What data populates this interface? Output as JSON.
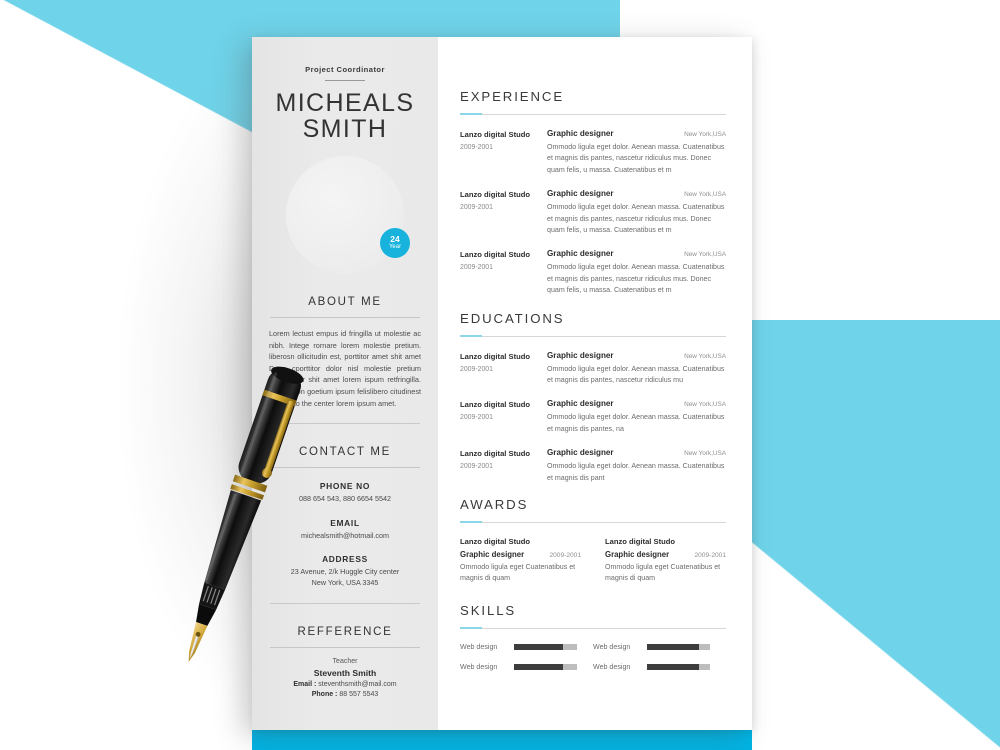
{
  "theme": {
    "accent_cyan": "#6fd3e9",
    "accent_bar": "#00b3e3",
    "badge_cyan": "#17b3dd",
    "sidebar_bg": "#e9e9e9",
    "heading_color": "#3a3a3a",
    "rule_accent": "#8bd6e8"
  },
  "sidebar": {
    "job_title": "Project Coordinator",
    "name_first": "MICHEALS",
    "name_last": "SMITH",
    "age_badge": {
      "number": "24",
      "unit": "Year"
    },
    "about": {
      "heading": "ABOUT ME",
      "text": "Lorem lectust empus id fringilla ut molestie ac nibh. Intege rornare lorem molestie pretium. liberosn ollicitudin est, porttitor amet shit amet  Done cporttitor dolor  nisl molestie pretium dolor dolor shit amet lorem ispum retfringilla. shitpr is on goetium ipsum felislibero citudinest to the center lorem ipsum amet."
    },
    "contact": {
      "heading": "CONTACT ME",
      "phone_label": "PHONE NO",
      "phone_value": "088 654 543, 880 6654 5542",
      "email_label": "EMAIL",
      "email_value": "michealsmith@hotmail.com",
      "address_label": "ADDRESS",
      "address_line1": "23 Avenue, 2/k Huggle City center",
      "address_line2": "New York, USA 3345"
    },
    "reference": {
      "heading": "REFFERENCE",
      "role": "Teacher",
      "name": "Steventh Smith",
      "email_label": "Email :",
      "email_value": "steventhsmith@mail.com",
      "phone_label": "Phone :",
      "phone_value": "88 557 5543"
    }
  },
  "main": {
    "experience": {
      "heading": "EXPERIENCE",
      "entries": [
        {
          "org": "Lanzo digital Studo",
          "date": "2009-2001",
          "role": "Graphic designer",
          "location": "New York,USA",
          "description": "Ommodo ligula eget dolor. Aenean massa. Cuatenatibus et magnis dis pantes, nascetur ridiculus mus. Donec quam felis, u massa. Cuatenatibus et m"
        },
        {
          "org": "Lanzo digital Studo",
          "date": "2009-2001",
          "role": "Graphic designer",
          "location": "New York,USA",
          "description": "Ommodo ligula eget dolor. Aenean massa. Cuatenatibus et magnis dis pantes, nascetur ridiculus mus. Donec quam felis, u massa. Cuatenatibus et m"
        },
        {
          "org": "Lanzo digital Studo",
          "date": "2009-2001",
          "role": "Graphic designer",
          "location": "New York,USA",
          "description": "Ommodo ligula eget dolor. Aenean massa. Cuatenatibus et magnis dis pantes, nascetur ridiculus mus. Donec quam felis, u massa. Cuatenatibus et m"
        }
      ]
    },
    "educations": {
      "heading": "EDUCATIONS",
      "entries": [
        {
          "org": "Lanzo digital Studo",
          "date": "2009-2001",
          "role": "Graphic designer",
          "location": "New York,USA",
          "description": "Ommodo ligula eget dolor. Aenean massa. Cuatenatibus et magnis dis pantes, nascetur ridiculus mu"
        },
        {
          "org": "Lanzo digital Studo",
          "date": "2009-2001",
          "role": "Graphic designer",
          "location": "New York,USA",
          "description": "Ommodo ligula eget dolor. Aenean massa. Cuatenatibus et magnis dis pantes, na"
        },
        {
          "org": "Lanzo digital Studo",
          "date": "2009-2001",
          "role": "Graphic designer",
          "location": "New York,USA",
          "description": "Ommodo ligula eget dolor. Aenean massa. Cuatenatibus et magnis dis pant"
        }
      ]
    },
    "awards": {
      "heading": "AWARDS",
      "items": [
        {
          "org": "Lanzo digital Studo",
          "role": "Graphic designer",
          "date": "2009-2001",
          "description": "Ommodo ligula eget  Cuatenatibus et magnis di quam"
        },
        {
          "org": "Lanzo digital Studo",
          "role": "Graphic designer",
          "date": "2009-2001",
          "description": "Ommodo ligula eget  Cuatenatibus et magnis di quam"
        }
      ]
    },
    "skills": {
      "heading": "SKILLS",
      "items": [
        {
          "name": "Web design",
          "percent": 78
        },
        {
          "name": "Web design",
          "percent": 83
        },
        {
          "name": "Web design",
          "percent": 78
        },
        {
          "name": "Web design",
          "percent": 83
        }
      ]
    }
  }
}
